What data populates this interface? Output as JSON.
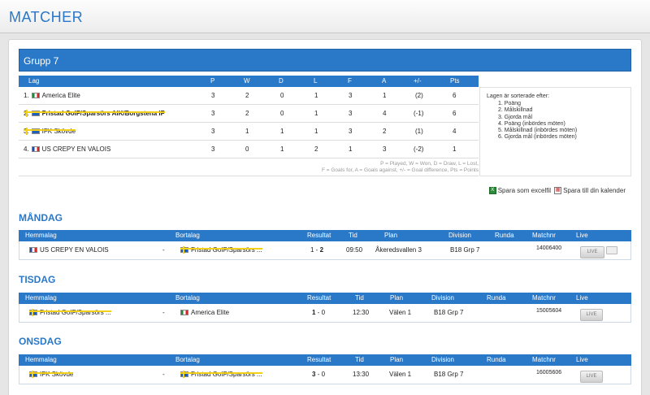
{
  "header": {
    "title": "MATCHER"
  },
  "group": {
    "title": "Grupp 7"
  },
  "standings": {
    "columns": [
      "Lag",
      "P",
      "W",
      "D",
      "L",
      "F",
      "A",
      "+/-",
      "Pts"
    ],
    "rows": [
      {
        "pos": "1.",
        "flag": "mx",
        "team": "America Elite",
        "p": "3",
        "w": "2",
        "d": "0",
        "l": "1",
        "f": "3",
        "a": "1",
        "diff": "(2)",
        "pts": "6"
      },
      {
        "pos": "2.",
        "flag": "se",
        "team": "Fristad GoIF/Sparsörs AIK/Borgstena IF",
        "p": "3",
        "w": "2",
        "d": "0",
        "l": "1",
        "f": "3",
        "a": "4",
        "diff": "(-1)",
        "pts": "6"
      },
      {
        "pos": "3.",
        "flag": "se",
        "team": "IFK Skövde",
        "p": "3",
        "w": "1",
        "d": "1",
        "l": "1",
        "f": "3",
        "a": "2",
        "diff": "(1)",
        "pts": "4"
      },
      {
        "pos": "4.",
        "flag": "fr",
        "team": "US CREPY EN VALOIS",
        "p": "3",
        "w": "0",
        "d": "1",
        "l": "2",
        "f": "1",
        "a": "3",
        "diff": "(-2)",
        "pts": "1"
      }
    ],
    "legend_line1": "P = Played, W = Won, D = Draw, L = Lost,",
    "legend_line2": "F = Goals for, A = Goals against, +/- = Goal difference, Pts = Points"
  },
  "sorting": {
    "heading": "Lagen är sorterade efter:",
    "items": [
      "1. Poäng",
      "2. Målskillnad",
      "3. Gjorda mål",
      "4. Poäng (inbördes möten)",
      "5. Målskillnad (inbördes möten)",
      "6. Gjorda mål (inbördes möten)"
    ]
  },
  "actions": {
    "excel": "Spara som excelfil",
    "calendar": "Spara till din kalender"
  },
  "match_columns": [
    "Hemmalag",
    "Bortalag",
    "Resultat",
    "Tid",
    "Plan",
    "Division",
    "Runda",
    "Matchnr",
    "Live"
  ],
  "days": [
    {
      "name": "MÅNDAG",
      "match": {
        "home_flag": "fr",
        "home": "US CREPY EN VALOIS",
        "sep": "-",
        "away_flag": "se",
        "away": "Fristad GoIF/Sparsörs ...",
        "res_home": "1",
        "res_sep": " - ",
        "res_away": "2",
        "bold": "away",
        "time": "09:50",
        "plan": "Åkeredsvallen 3",
        "division": "B18 Grp 7",
        "runda": "",
        "matchnr": "14006400",
        "live": "LIVE"
      }
    },
    {
      "name": "TISDAG",
      "match": {
        "home_flag": "se",
        "home": "Fristad GoIF/Sparsörs ...",
        "sep": "-",
        "away_flag": "mx",
        "away": "America Elite",
        "res_home": "1",
        "res_sep": " - ",
        "res_away": "0",
        "bold": "home",
        "time": "12:30",
        "plan": "Välen 1",
        "division": "B18 Grp 7",
        "runda": "",
        "matchnr": "15005604",
        "live": "LIVE"
      }
    },
    {
      "name": "ONSDAG",
      "match": {
        "home_flag": "se",
        "home": "IFK Skövde",
        "sep": "-",
        "away_flag": "se",
        "away": "Fristad GoIF/Sparsörs ...",
        "res_home": "3",
        "res_sep": " - ",
        "res_away": "0",
        "bold": "home",
        "time": "13:30",
        "plan": "Välen 1",
        "division": "B18 Grp 7",
        "runda": "",
        "matchnr": "16005606",
        "live": "LIVE"
      }
    }
  ]
}
